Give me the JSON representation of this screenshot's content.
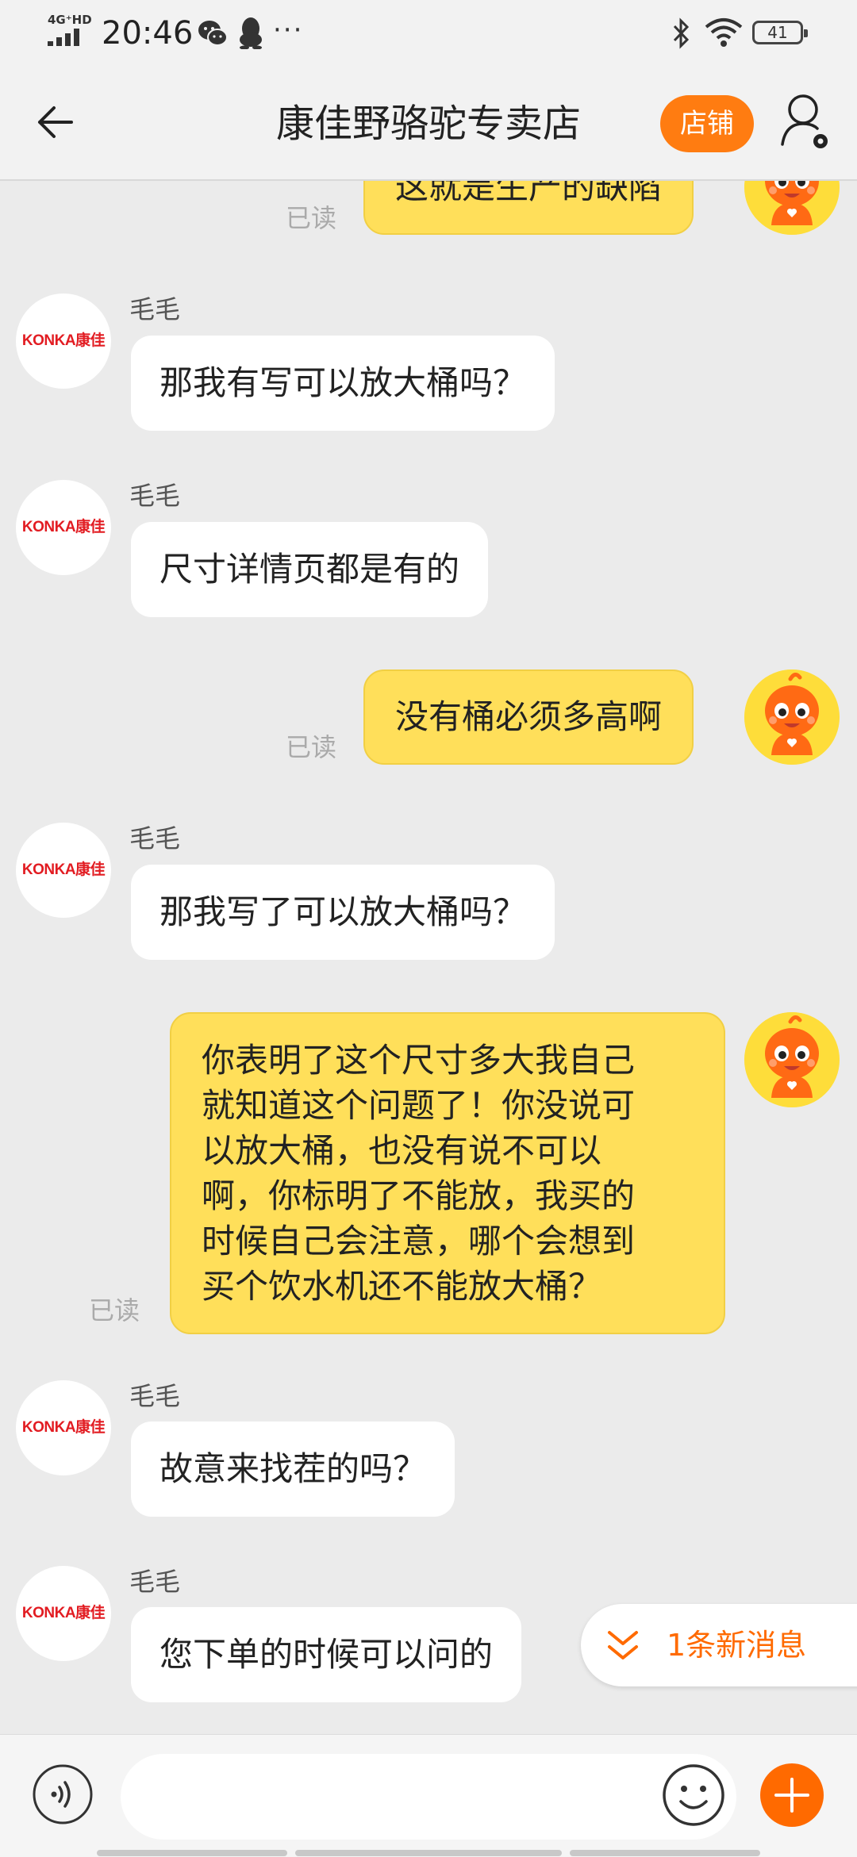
{
  "status_bar": {
    "network": "4G⁺HD",
    "time": "20:46",
    "more": "···",
    "battery": "41"
  },
  "header": {
    "title": "康佳野骆驼专卖店",
    "store_button": "店铺"
  },
  "messages": [
    {
      "direction": "out",
      "text": "这就是生产的缺陷",
      "status": "已读"
    },
    {
      "direction": "in",
      "sender": "毛毛",
      "text": "那我有写可以放大桶吗？",
      "avatar_logo": "KONKA康佳"
    },
    {
      "direction": "in",
      "sender": "毛毛",
      "text": "尺寸详情页都是有的",
      "avatar_logo": "KONKA康佳"
    },
    {
      "direction": "out",
      "text": "没有桶必须多高啊",
      "status": "已读"
    },
    {
      "direction": "in",
      "sender": "毛毛",
      "text": "那我写了可以放大桶吗？",
      "avatar_logo": "KONKA康佳"
    },
    {
      "direction": "out",
      "lines": [
        "你表明了这个尺寸多大我自己",
        "就知道这个问题了！你没说可",
        "以放大桶，也没有说不可以",
        "啊，你标明了不能放，我买的",
        "时候自己会注意，哪个会想到",
        "买个饮水机还不能放大桶？"
      ],
      "status": "已读"
    },
    {
      "direction": "in",
      "sender": "毛毛",
      "text": "故意来找茬的吗？",
      "avatar_logo": "KONKA康佳"
    },
    {
      "direction": "in",
      "sender": "毛毛",
      "text": "您下单的时候可以问的",
      "avatar_logo": "KONKA康佳"
    }
  ],
  "new_message_pill": {
    "text": "1条新消息",
    "icon": "double-chevron-down-icon"
  },
  "input_bar": {
    "placeholder": "",
    "voice_icon": "voice-icon",
    "emoji_icon": "emoji-icon",
    "plus_icon": "plus-icon"
  },
  "colors": {
    "accent": "#ff7c11",
    "outgoing_bubble": "#ffdf5a",
    "incoming_bubble": "#ffffff",
    "chat_background": "#ebebeb",
    "konka_red": "#e21c22"
  }
}
